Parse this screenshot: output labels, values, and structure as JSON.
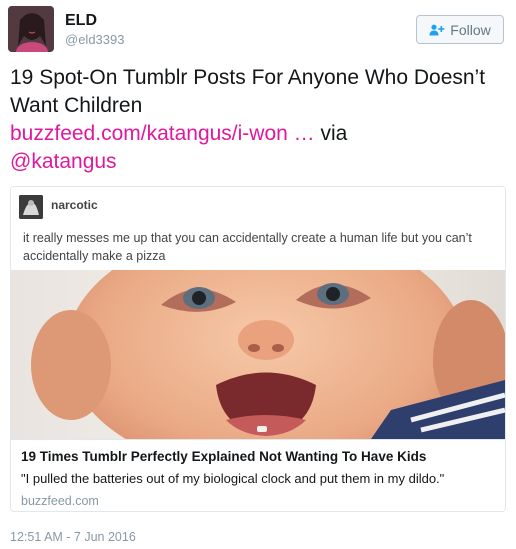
{
  "user": {
    "name": "ELD",
    "handle": "@eld3393",
    "avatar_icon": "profile-photo"
  },
  "follow_button": {
    "label": "Follow",
    "icon": "add-user-icon"
  },
  "tweet": {
    "line1": "19 Spot-On Tumblr Posts For Anyone Who Doesn’t Want Children",
    "link": "buzzfeed.com/katangus/i-won …",
    "via": " via",
    "mention": "@katangus",
    "timestamp": "12:51 AM - 7 Jun 2016"
  },
  "card": {
    "tumblr_user": "narcotic",
    "tumblr_text": "it really messes me up that you can accidentally create a human life but you can’t accidentally make a pizza",
    "title": "19 Times Tumblr Perfectly Explained Not Wanting To Have Kids",
    "description": "\"I pulled the batteries out of my biological clock and put them in my dildo.\"",
    "domain": "buzzfeed.com"
  },
  "colors": {
    "link": "#e0189e",
    "muted": "#8899a6",
    "text": "#14171a"
  }
}
